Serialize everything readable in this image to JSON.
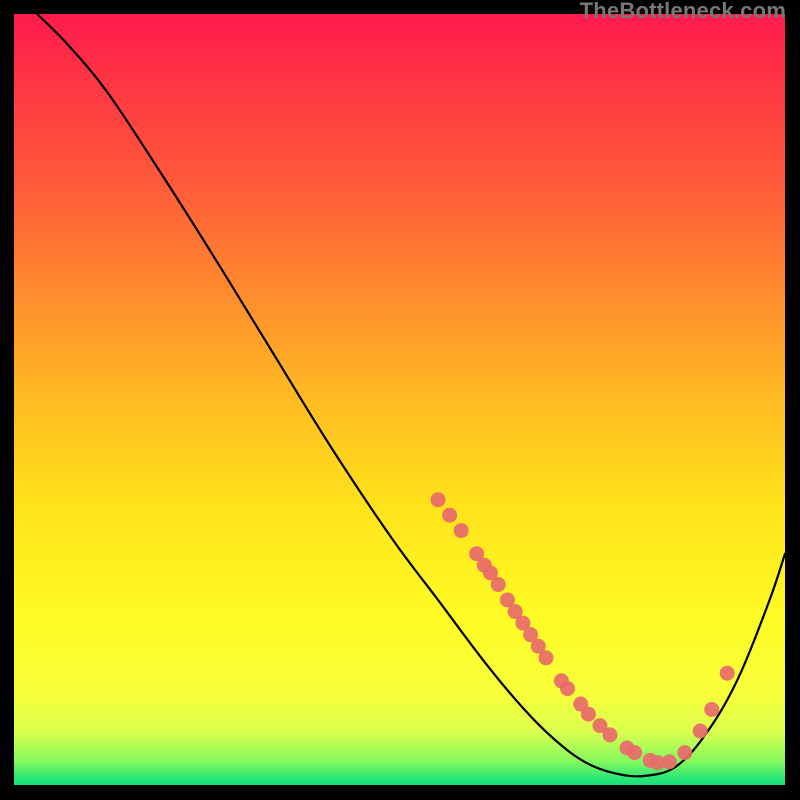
{
  "watermark": "TheBottleneck.com",
  "chart_data": {
    "type": "line",
    "title": "",
    "xlabel": "",
    "ylabel": "",
    "xlim": [
      0,
      100
    ],
    "ylim": [
      0,
      100
    ],
    "curve": [
      {
        "x": 3.0,
        "y": 100.0
      },
      {
        "x": 7.0,
        "y": 96.0
      },
      {
        "x": 12.0,
        "y": 90.0
      },
      {
        "x": 18.0,
        "y": 81.0
      },
      {
        "x": 25.0,
        "y": 70.0
      },
      {
        "x": 33.0,
        "y": 57.0
      },
      {
        "x": 41.0,
        "y": 44.0
      },
      {
        "x": 49.0,
        "y": 32.0
      },
      {
        "x": 55.0,
        "y": 24.0
      },
      {
        "x": 61.0,
        "y": 16.0
      },
      {
        "x": 66.0,
        "y": 10.0
      },
      {
        "x": 70.0,
        "y": 6.0
      },
      {
        "x": 74.0,
        "y": 3.0
      },
      {
        "x": 78.0,
        "y": 1.5
      },
      {
        "x": 82.0,
        "y": 1.2
      },
      {
        "x": 86.0,
        "y": 2.5
      },
      {
        "x": 90.0,
        "y": 7.0
      },
      {
        "x": 94.0,
        "y": 14.0
      },
      {
        "x": 98.0,
        "y": 24.0
      },
      {
        "x": 100.0,
        "y": 30.0
      }
    ],
    "dots": [
      {
        "x": 55.0,
        "y": 37.0
      },
      {
        "x": 56.5,
        "y": 35.0
      },
      {
        "x": 58.0,
        "y": 33.0
      },
      {
        "x": 60.0,
        "y": 30.0
      },
      {
        "x": 61.0,
        "y": 28.5
      },
      {
        "x": 61.8,
        "y": 27.5
      },
      {
        "x": 62.8,
        "y": 26.0
      },
      {
        "x": 64.0,
        "y": 24.0
      },
      {
        "x": 65.0,
        "y": 22.5
      },
      {
        "x": 66.0,
        "y": 21.0
      },
      {
        "x": 67.0,
        "y": 19.5
      },
      {
        "x": 68.0,
        "y": 18.0
      },
      {
        "x": 69.0,
        "y": 16.5
      },
      {
        "x": 71.0,
        "y": 13.5
      },
      {
        "x": 71.8,
        "y": 12.5
      },
      {
        "x": 73.5,
        "y": 10.5
      },
      {
        "x": 74.5,
        "y": 9.2
      },
      {
        "x": 76.0,
        "y": 7.7
      },
      {
        "x": 77.3,
        "y": 6.5
      },
      {
        "x": 79.5,
        "y": 4.8
      },
      {
        "x": 80.5,
        "y": 4.2
      },
      {
        "x": 82.5,
        "y": 3.2
      },
      {
        "x": 83.5,
        "y": 2.9
      },
      {
        "x": 85.0,
        "y": 3.0
      },
      {
        "x": 87.0,
        "y": 4.2
      },
      {
        "x": 89.0,
        "y": 7.0
      },
      {
        "x": 90.5,
        "y": 9.8
      },
      {
        "x": 92.5,
        "y": 14.5
      }
    ],
    "colors": {
      "line": "#000000",
      "dot_fill": "#e86a6a",
      "dot_stroke": "#c94f4f"
    }
  }
}
